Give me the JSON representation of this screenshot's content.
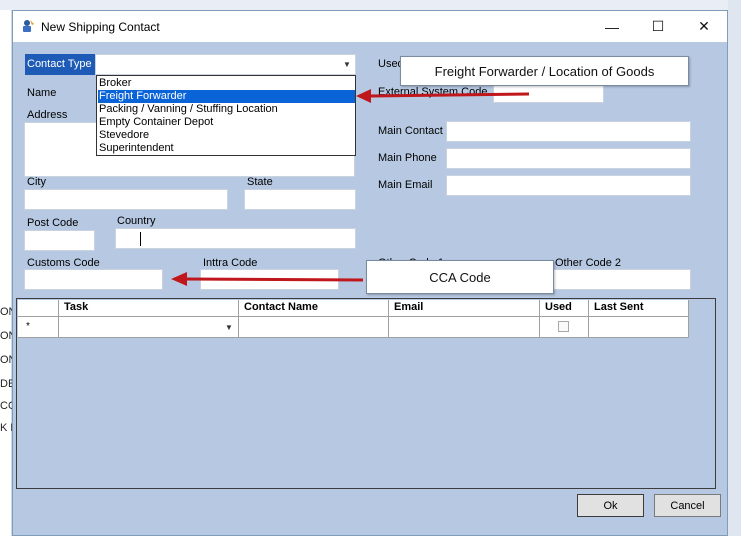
{
  "window": {
    "title": "New Shipping Contact",
    "minimize_glyph": "—",
    "maximize_glyph": "☐",
    "close_glyph": "✕"
  },
  "background": {
    "fragments": [
      "ON",
      "ON",
      "ON",
      "DE",
      "CO",
      "K P"
    ]
  },
  "form": {
    "contact_type_label": "Contact Type",
    "contact_type_value": "",
    "name_label": "Name",
    "address_label": "Address",
    "city_label": "City",
    "state_label": "State",
    "post_code_label": "Post Code",
    "country_label": "Country",
    "customs_code_label": "Customs Code",
    "inttra_code_label": "Inttra Code",
    "used_label": "Used",
    "external_system_code_label": "External System Code",
    "main_contact_label": "Main Contact",
    "main_phone_label": "Main Phone",
    "main_email_label": "Main Email",
    "other_code_1_label": "Other Code 1",
    "other_code_2_label": "Other Code 2"
  },
  "dropdown": {
    "options": [
      "Broker",
      "Freight Forwarder",
      "Packing / Vanning / Stuffing Location",
      "Empty Container Depot",
      "Stevedore",
      "Superintendent"
    ],
    "selected_index": 1
  },
  "callouts": {
    "freight": "Freight Forwarder / Location of Goods",
    "cca": "CCA Code",
    "arrow_color": "#c0171c"
  },
  "grid": {
    "columns": [
      "",
      "Task",
      "Contact Name",
      "Email",
      "Used",
      "Last Sent"
    ],
    "new_row_marker": "*"
  },
  "buttons": {
    "ok": "Ok",
    "cancel": "Cancel"
  }
}
